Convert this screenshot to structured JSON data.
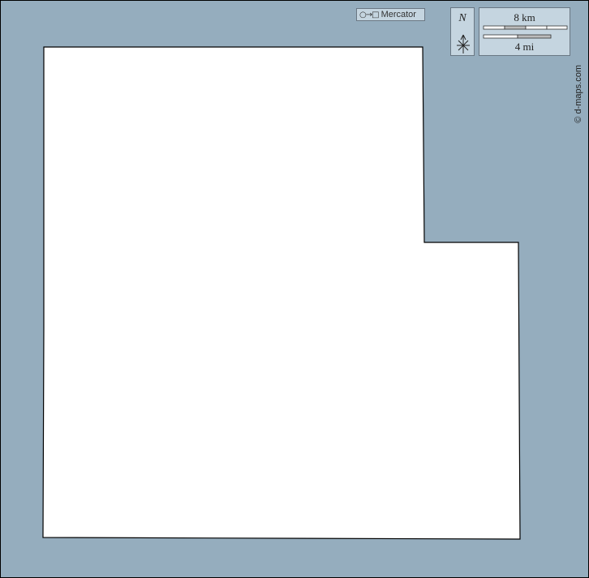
{
  "map": {
    "water_color": "#95adbe",
    "land_color": "#ffffff",
    "border_color": "#000000",
    "region_shape": "L-shaped county outline (blank)"
  },
  "projection": {
    "glyph": "○→□",
    "label": "Mercator"
  },
  "north_arrow": {
    "label": "N",
    "icon": "north-arrow-icon"
  },
  "scale_bar": {
    "km_label": "8 km",
    "mi_label": "4 mi"
  },
  "credit": {
    "text": "© d-maps.com"
  }
}
